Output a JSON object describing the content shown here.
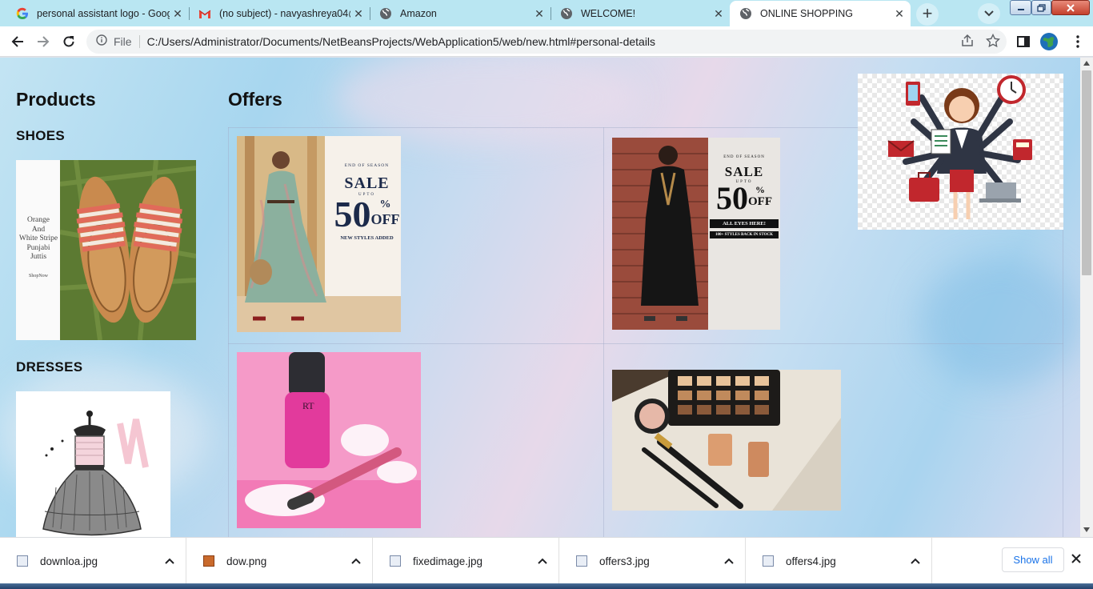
{
  "tabs": [
    {
      "title": "personal assistant logo - Goog",
      "icon": "google-icon",
      "active": false
    },
    {
      "title": "(no subject) - navyashreya04@",
      "icon": "gmail-icon",
      "active": false
    },
    {
      "title": "Amazon",
      "icon": "globe-icon",
      "active": false
    },
    {
      "title": "WELCOME!",
      "icon": "globe-icon",
      "active": false
    },
    {
      "title": "ONLINE SHOPPING",
      "icon": "globe-icon",
      "active": true
    }
  ],
  "omnibox": {
    "file_label": "File",
    "url": "C:/Users/Administrator/Documents/NetBeansProjects/WebApplication5/web/new.html#personal-details"
  },
  "page": {
    "products_title": "Products",
    "shoes_title": "SHOES",
    "dresses_title": "DRESSES",
    "offers_title": "Offers",
    "shoe_image_text": [
      "Orange",
      "And",
      "White Stripe",
      "Punjabi",
      "Juttis",
      "ShopNow"
    ],
    "sale_text_1": [
      "END OF SEASON",
      "SALE",
      "UPTO",
      "50",
      "%",
      "OFF",
      "NEW STYLES ADDED"
    ],
    "sale_text_2": [
      "END OF SEASON",
      "SALE",
      "UPTO",
      "50",
      "%",
      "OFF",
      "ALL EYES HERE!",
      "100+ STYLES BACK IN STOCK"
    ],
    "cosmetic_brand": "RT"
  },
  "downloads": [
    {
      "name": "downloa.jpg",
      "icon": "image-file-icon"
    },
    {
      "name": "dow.png",
      "icon": "image-file-icon"
    },
    {
      "name": "fixedimage.jpg",
      "icon": "image-file-icon"
    },
    {
      "name": "offers3.jpg",
      "icon": "image-file-icon"
    },
    {
      "name": "offers4.jpg",
      "icon": "image-file-icon"
    }
  ],
  "show_all_label": "Show all",
  "colors": {
    "tabbar": "#b9e6f2",
    "link": "#1a73e8"
  }
}
